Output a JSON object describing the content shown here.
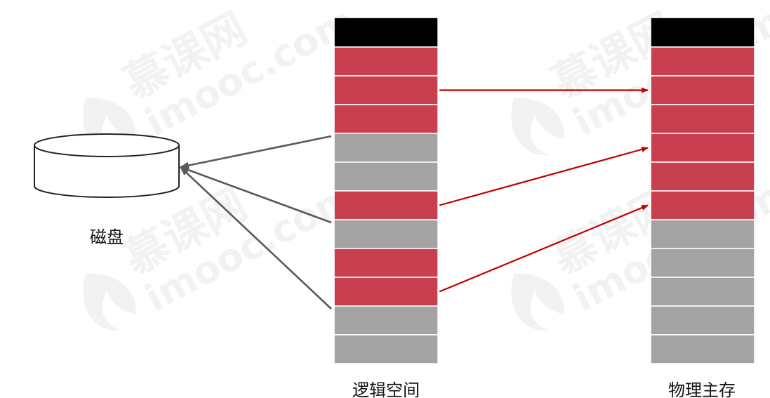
{
  "labels": {
    "disk": "磁盘",
    "logical_space": "逻辑空间",
    "physical_memory": "物理主存"
  },
  "watermark": {
    "brand": "慕课网",
    "site": "imooc.com"
  },
  "colors": {
    "header": "#000000",
    "loaded_page": "#c8404f",
    "unloaded_page": "#a3a3a3",
    "mapping_arrow": "#c00000",
    "swap_arrow": "#5a5a5a",
    "watermark": "#f2f2f2"
  },
  "logical_space": {
    "blocks": [
      "header",
      "red",
      "red",
      "red",
      "gray",
      "gray",
      "red",
      "gray",
      "red",
      "red",
      "gray",
      "gray"
    ]
  },
  "physical_memory": {
    "blocks": [
      "header",
      "red",
      "red",
      "red",
      "red",
      "red",
      "red",
      "gray",
      "gray",
      "gray",
      "gray",
      "gray"
    ]
  },
  "mappings": [
    {
      "from": 2,
      "to": 2
    },
    {
      "from": 6,
      "to": 4
    },
    {
      "from": 9,
      "to": 6
    }
  ],
  "swaps_to_disk": [
    4,
    7,
    10
  ]
}
